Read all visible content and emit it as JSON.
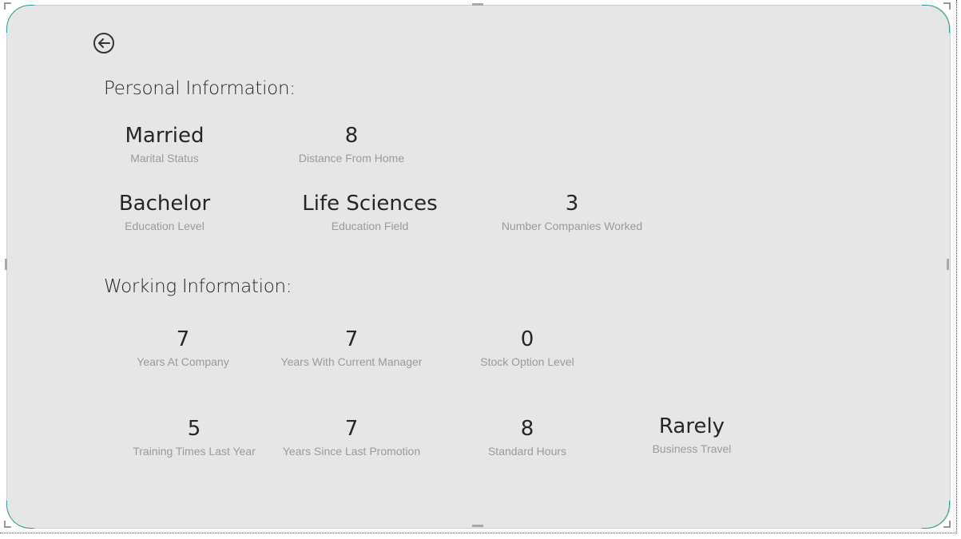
{
  "header": {
    "back_icon": "arrow-left-circle-icon"
  },
  "personal": {
    "title": "Personal Information:",
    "marital_status": {
      "value": "Married",
      "label": "Marital Status"
    },
    "distance_from_home": {
      "value": "8",
      "label": "Distance From Home"
    },
    "education_level": {
      "value": "Bachelor",
      "label": "Education Level"
    },
    "education_field": {
      "value": "Life Sciences",
      "label": "Education Field"
    },
    "num_companies_worked": {
      "value": "3",
      "label": "Number Companies Worked"
    }
  },
  "working": {
    "title": "Working Information:",
    "years_at_company": {
      "value": "7",
      "label": "Years At Company"
    },
    "years_with_manager": {
      "value": "7",
      "label": "Years With Current Manager"
    },
    "stock_option_level": {
      "value": "0",
      "label": "Stock Option Level"
    },
    "training_times": {
      "value": "5",
      "label": "Training Times Last Year"
    },
    "years_since_promotion": {
      "value": "7",
      "label": "Years Since Last Promotion"
    },
    "standard_hours": {
      "value": "8",
      "label": "Standard Hours"
    },
    "business_travel": {
      "value": "Rarely",
      "label": "Business Travel"
    }
  },
  "colors": {
    "background": "#e6e6e6",
    "value_text": "#262626",
    "label_text": "#9a9a9a",
    "accent": "#2aa198"
  }
}
